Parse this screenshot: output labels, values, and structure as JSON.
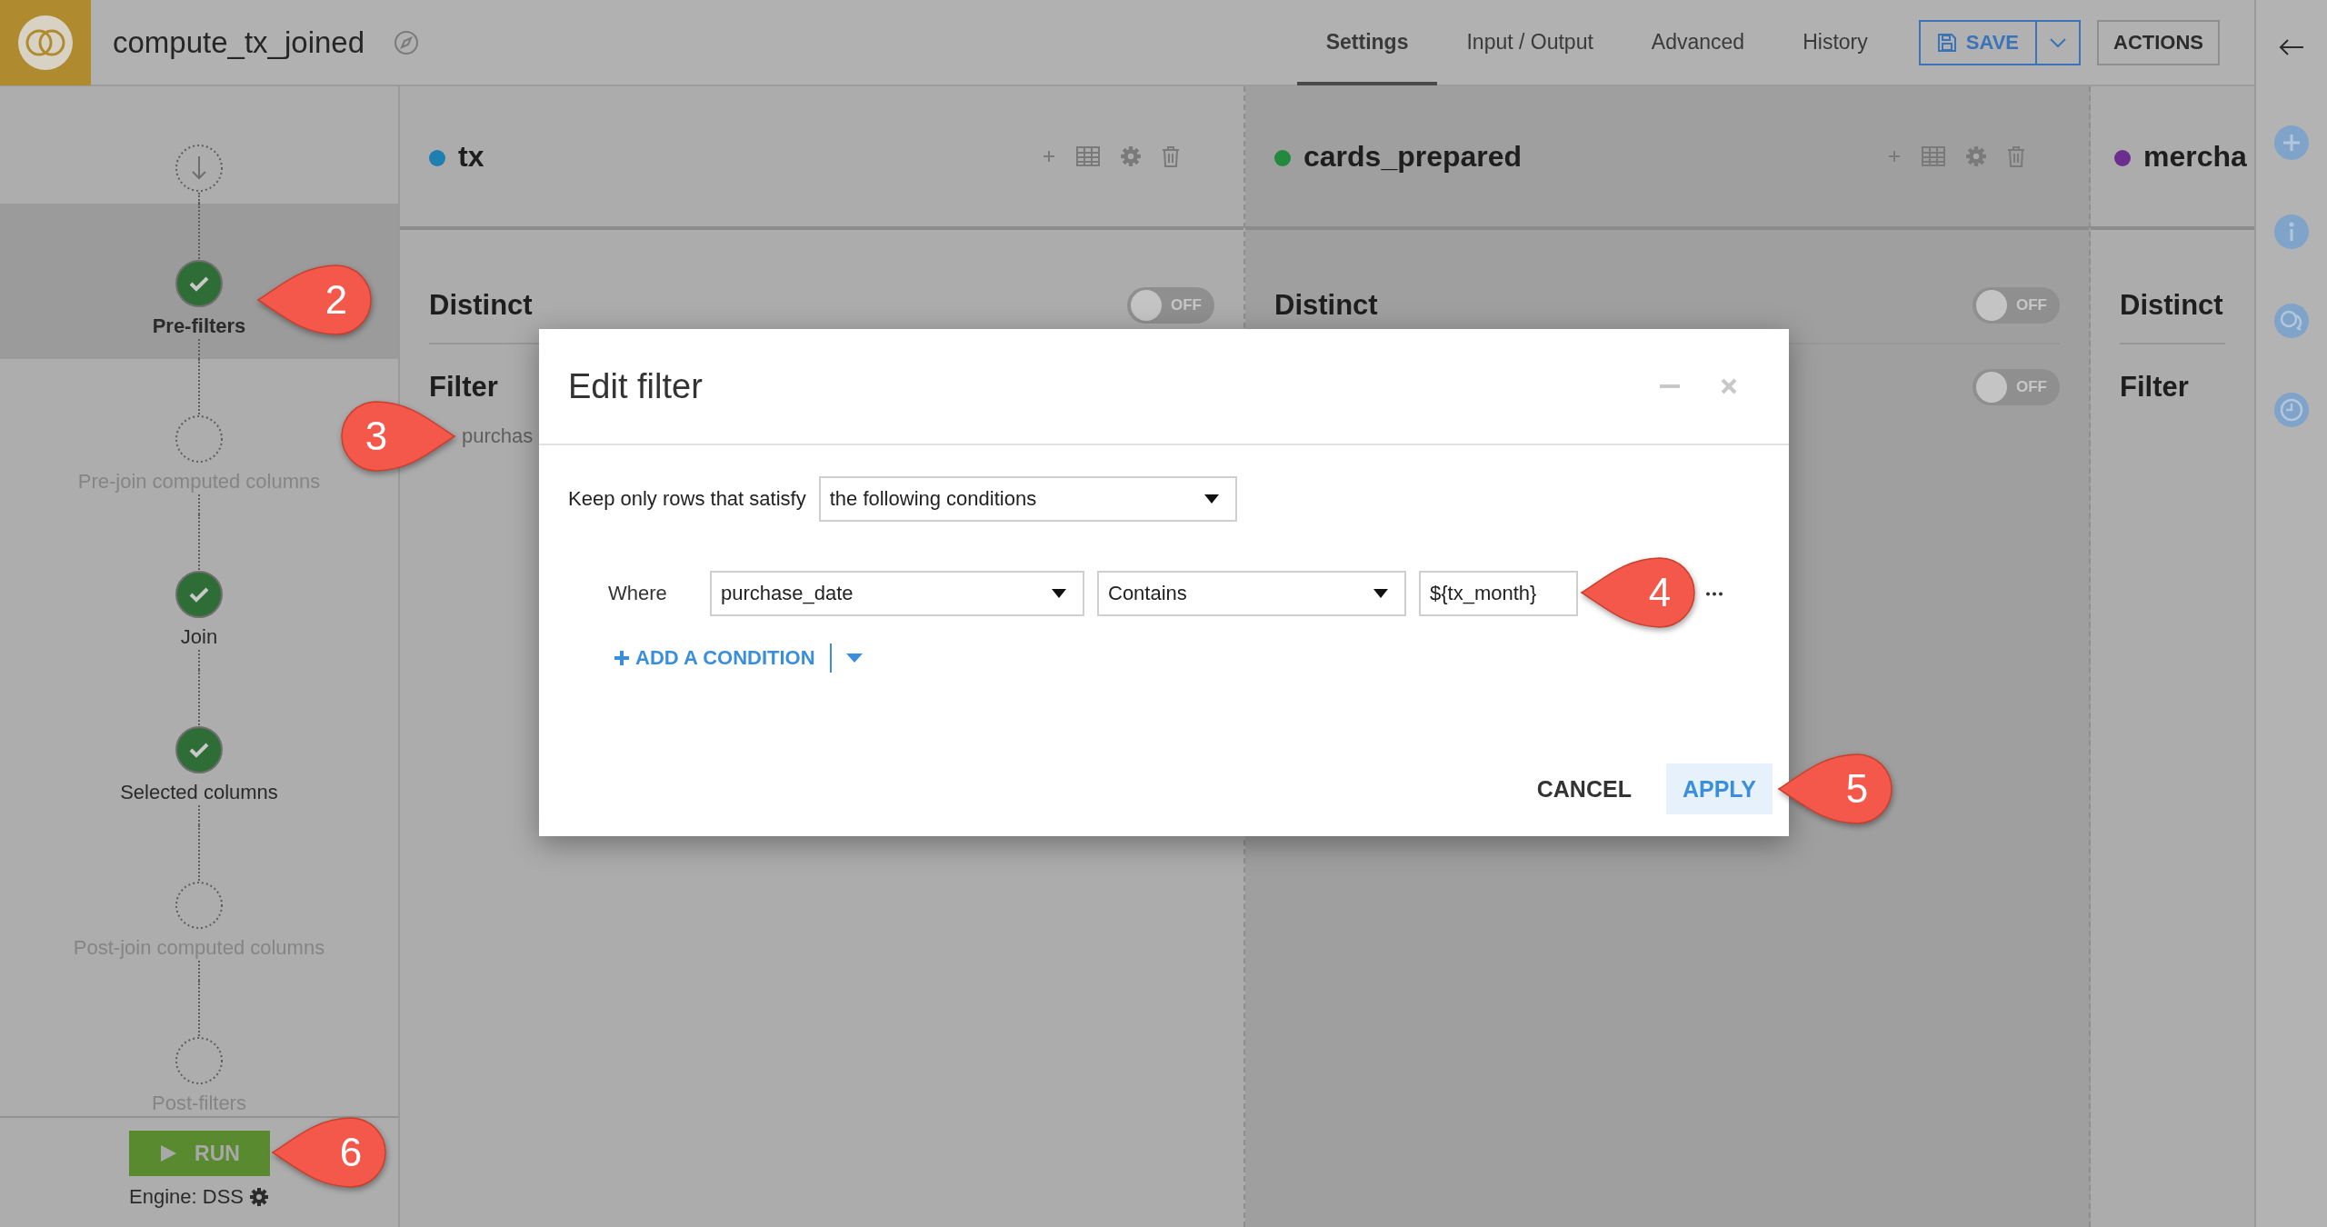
{
  "app": {
    "title": "compute_tx_joined"
  },
  "tabs": [
    {
      "label": "Settings",
      "selected": true
    },
    {
      "label": "Input / Output",
      "selected": false
    },
    {
      "label": "Advanced",
      "selected": false
    },
    {
      "label": "History",
      "selected": false
    }
  ],
  "save_button": "SAVE",
  "actions_button": "ACTIONS",
  "steps": [
    {
      "kind": "input"
    },
    {
      "kind": "step",
      "label": "Pre-filters",
      "completed": true,
      "selected": true
    },
    {
      "kind": "step",
      "label": "Pre-join computed columns",
      "completed": false,
      "selected": false
    },
    {
      "kind": "step",
      "label": "Join",
      "completed": true,
      "selected": false
    },
    {
      "kind": "step",
      "label": "Selected columns",
      "completed": true,
      "selected": false
    },
    {
      "kind": "step",
      "label": "Post-join computed columns",
      "completed": false,
      "selected": false
    },
    {
      "kind": "step",
      "label": "Post-filters",
      "completed": false,
      "selected": false
    }
  ],
  "run_button": "RUN",
  "engine": "Engine: DSS",
  "datasets": [
    {
      "name": "tx",
      "color": "#1f7fb0",
      "selected": false,
      "distinct_label": "Distinct",
      "distinct_toggle": {
        "on": false,
        "label": "OFF"
      },
      "filter_label": "Filter",
      "filter_summary": "purchas"
    },
    {
      "name": "cards_prepared",
      "color": "#23893e",
      "selected": true,
      "distinct_label": "Distinct",
      "distinct_toggle": {
        "on": false,
        "label": "OFF"
      },
      "filter_toggle": {
        "on": false,
        "label": "OFF"
      }
    },
    {
      "name": "mercha",
      "color": "#6b2e8f",
      "selected": false,
      "distinct_label": "Distinct",
      "filter_label": "Filter"
    }
  ],
  "modal": {
    "title": "Edit filter",
    "keep_label": "Keep only rows that satisfy",
    "mode": "the following conditions",
    "conditions": [
      {
        "where_label": "Where",
        "column": "purchase_date",
        "operator": "Contains",
        "value": "${tx_month}"
      }
    ],
    "add_condition": "ADD A CONDITION",
    "cancel": "CANCEL",
    "apply": "APPLY"
  },
  "callouts": [
    {
      "number": "2"
    },
    {
      "number": "3"
    },
    {
      "number": "4"
    },
    {
      "number": "5"
    },
    {
      "number": "6"
    }
  ]
}
